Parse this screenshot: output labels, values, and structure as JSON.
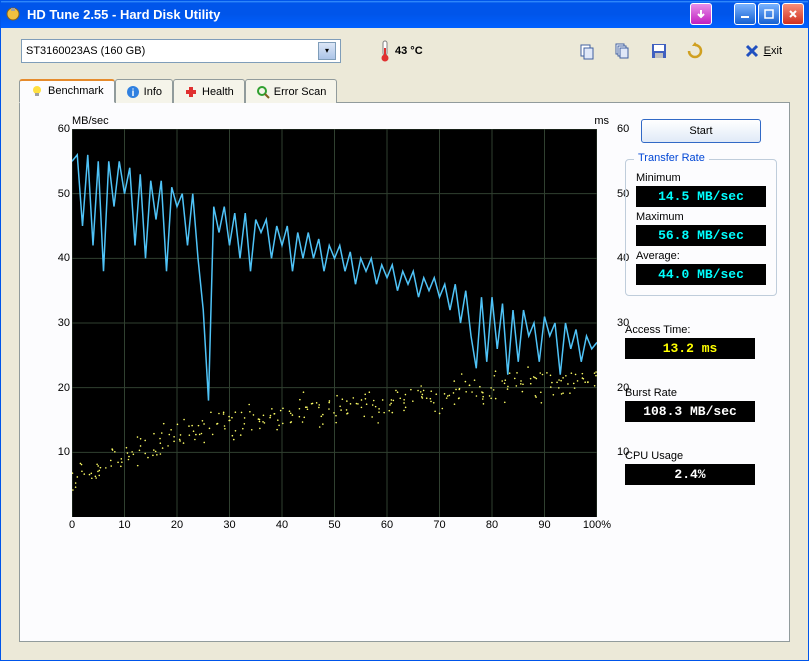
{
  "window": {
    "title": "HD Tune 2.55 - Hard Disk Utility"
  },
  "toolbar": {
    "drive": "ST3160023AS (160 GB)",
    "temp": "43 °C",
    "exit_label": "Exit",
    "icons": [
      "copy-icon",
      "copy-multi-icon",
      "save-icon",
      "refresh-icon"
    ]
  },
  "tabs": [
    {
      "label": "Benchmark",
      "active": true
    },
    {
      "label": "Info",
      "active": false
    },
    {
      "label": "Health",
      "active": false
    },
    {
      "label": "Error Scan",
      "active": false
    }
  ],
  "chart_data": {
    "type": "line+scatter",
    "title": "",
    "xlabel": "%",
    "ylabel_left": "MB/sec",
    "ylabel_right": "ms",
    "xlim": [
      0,
      100
    ],
    "ylim_left": [
      0,
      60
    ],
    "ylim_right": [
      0,
      60
    ],
    "x_ticks": [
      0,
      10,
      20,
      30,
      40,
      50,
      60,
      70,
      80,
      90,
      100
    ],
    "y_ticks": [
      10,
      20,
      30,
      40,
      50,
      60
    ],
    "series": [
      {
        "name": "Transfer Rate (MB/sec)",
        "type": "line",
        "color": "#4fc3f7",
        "values": [
          [
            0,
            55
          ],
          [
            1,
            56
          ],
          [
            2,
            45
          ],
          [
            3,
            56
          ],
          [
            4,
            42
          ],
          [
            5,
            55
          ],
          [
            6,
            38
          ],
          [
            7,
            55
          ],
          [
            8,
            48
          ],
          [
            9,
            55
          ],
          [
            10,
            50
          ],
          [
            11,
            54
          ],
          [
            12,
            42
          ],
          [
            13,
            53
          ],
          [
            14,
            40
          ],
          [
            15,
            52
          ],
          [
            16,
            46
          ],
          [
            17,
            52
          ],
          [
            18,
            38
          ],
          [
            19,
            51
          ],
          [
            20,
            48
          ],
          [
            21,
            50
          ],
          [
            22,
            42
          ],
          [
            23,
            50
          ],
          [
            24,
            40
          ],
          [
            25,
            32
          ],
          [
            26,
            18
          ],
          [
            27,
            48
          ],
          [
            28,
            44
          ],
          [
            29,
            48
          ],
          [
            30,
            42
          ],
          [
            31,
            47
          ],
          [
            32,
            40
          ],
          [
            33,
            47
          ],
          [
            34,
            38
          ],
          [
            35,
            46
          ],
          [
            36,
            44
          ],
          [
            37,
            46
          ],
          [
            38,
            40
          ],
          [
            39,
            45
          ],
          [
            40,
            42
          ],
          [
            41,
            45
          ],
          [
            42,
            38
          ],
          [
            43,
            44
          ],
          [
            44,
            40
          ],
          [
            45,
            44
          ],
          [
            46,
            40
          ],
          [
            47,
            43
          ],
          [
            48,
            38
          ],
          [
            49,
            42
          ],
          [
            50,
            40
          ],
          [
            51,
            42
          ],
          [
            52,
            38
          ],
          [
            53,
            41
          ],
          [
            54,
            36
          ],
          [
            55,
            40
          ],
          [
            56,
            38
          ],
          [
            57,
            40
          ],
          [
            58,
            36
          ],
          [
            59,
            39
          ],
          [
            60,
            37
          ],
          [
            61,
            39
          ],
          [
            62,
            35
          ],
          [
            63,
            38
          ],
          [
            64,
            36
          ],
          [
            65,
            38
          ],
          [
            66,
            34
          ],
          [
            67,
            37
          ],
          [
            68,
            35
          ],
          [
            69,
            37
          ],
          [
            70,
            34
          ],
          [
            71,
            36
          ],
          [
            72,
            32
          ],
          [
            73,
            36
          ],
          [
            74,
            30
          ],
          [
            75,
            35
          ],
          [
            76,
            28
          ],
          [
            77,
            23
          ],
          [
            78,
            34
          ],
          [
            79,
            24
          ],
          [
            80,
            34
          ],
          [
            81,
            26
          ],
          [
            82,
            33
          ],
          [
            83,
            22
          ],
          [
            84,
            32
          ],
          [
            85,
            24
          ],
          [
            86,
            32
          ],
          [
            87,
            28
          ],
          [
            88,
            30
          ],
          [
            89,
            24
          ],
          [
            90,
            31
          ],
          [
            91,
            28
          ],
          [
            92,
            30
          ],
          [
            93,
            22
          ],
          [
            94,
            30
          ],
          [
            95,
            26
          ],
          [
            96,
            29
          ],
          [
            97,
            24
          ],
          [
            98,
            28
          ],
          [
            99,
            26
          ],
          [
            100,
            27
          ]
        ]
      },
      {
        "name": "Access Time (ms)",
        "type": "scatter",
        "color": "#ffff66",
        "values": [
          [
            0,
            5
          ],
          [
            1,
            6
          ],
          [
            2,
            7
          ],
          [
            3,
            6
          ],
          [
            4,
            7
          ],
          [
            5,
            8
          ],
          [
            6,
            7
          ],
          [
            7,
            9
          ],
          [
            8,
            8
          ],
          [
            9,
            10
          ],
          [
            10,
            9
          ],
          [
            11,
            10
          ],
          [
            12,
            9
          ],
          [
            13,
            11
          ],
          [
            14,
            10
          ],
          [
            15,
            11
          ],
          [
            16,
            12
          ],
          [
            17,
            11
          ],
          [
            18,
            13
          ],
          [
            19,
            12
          ],
          [
            20,
            13
          ],
          [
            21,
            12
          ],
          [
            22,
            14
          ],
          [
            23,
            13
          ],
          [
            24,
            14
          ],
          [
            25,
            13
          ],
          [
            26,
            15
          ],
          [
            27,
            14
          ],
          [
            28,
            15
          ],
          [
            29,
            14
          ],
          [
            30,
            13
          ],
          [
            31,
            14
          ],
          [
            32,
            15
          ],
          [
            33,
            14
          ],
          [
            34,
            16
          ],
          [
            35,
            15
          ],
          [
            36,
            14
          ],
          [
            37,
            16
          ],
          [
            38,
            17
          ],
          [
            39,
            15
          ],
          [
            40,
            14
          ],
          [
            41,
            16
          ],
          [
            42,
            15
          ],
          [
            43,
            17
          ],
          [
            44,
            16
          ],
          [
            45,
            18
          ],
          [
            46,
            17
          ],
          [
            47,
            16
          ],
          [
            48,
            15
          ],
          [
            49,
            17
          ],
          [
            50,
            16
          ],
          [
            51,
            18
          ],
          [
            52,
            17
          ],
          [
            53,
            16
          ],
          [
            54,
            18
          ],
          [
            55,
            17
          ],
          [
            56,
            19
          ],
          [
            57,
            18
          ],
          [
            58,
            17
          ],
          [
            59,
            16
          ],
          [
            60,
            18
          ],
          [
            61,
            17
          ],
          [
            62,
            19
          ],
          [
            63,
            18
          ],
          [
            64,
            17
          ],
          [
            65,
            19
          ],
          [
            66,
            18
          ],
          [
            67,
            20
          ],
          [
            68,
            19
          ],
          [
            69,
            18
          ],
          [
            70,
            17
          ],
          [
            71,
            19
          ],
          [
            72,
            18
          ],
          [
            73,
            20
          ],
          [
            74,
            19
          ],
          [
            75,
            21
          ],
          [
            76,
            20
          ],
          [
            77,
            19
          ],
          [
            78,
            18
          ],
          [
            79,
            20
          ],
          [
            80,
            19
          ],
          [
            81,
            21
          ],
          [
            82,
            20
          ],
          [
            83,
            19
          ],
          [
            84,
            21
          ],
          [
            85,
            20
          ],
          [
            86,
            22
          ],
          [
            87,
            21
          ],
          [
            88,
            20
          ],
          [
            89,
            19
          ],
          [
            90,
            21
          ],
          [
            91,
            20
          ],
          [
            92,
            22
          ],
          [
            93,
            21
          ],
          [
            94,
            20
          ],
          [
            95,
            22
          ],
          [
            96,
            21
          ],
          [
            97,
            20
          ],
          [
            98,
            22
          ],
          [
            99,
            21
          ],
          [
            100,
            21
          ]
        ]
      }
    ]
  },
  "results": {
    "start_label": "Start",
    "transfer_rate": {
      "title": "Transfer Rate",
      "minimum_label": "Minimum",
      "minimum_value": "14.5 MB/sec",
      "maximum_label": "Maximum",
      "maximum_value": "56.8 MB/sec",
      "average_label": "Average:",
      "average_value": "44.0 MB/sec"
    },
    "access_time": {
      "label": "Access Time:",
      "value": "13.2 ms"
    },
    "burst_rate": {
      "label": "Burst Rate",
      "value": "108.3 MB/sec"
    },
    "cpu_usage": {
      "label": "CPU Usage",
      "value": "2.4%"
    }
  }
}
